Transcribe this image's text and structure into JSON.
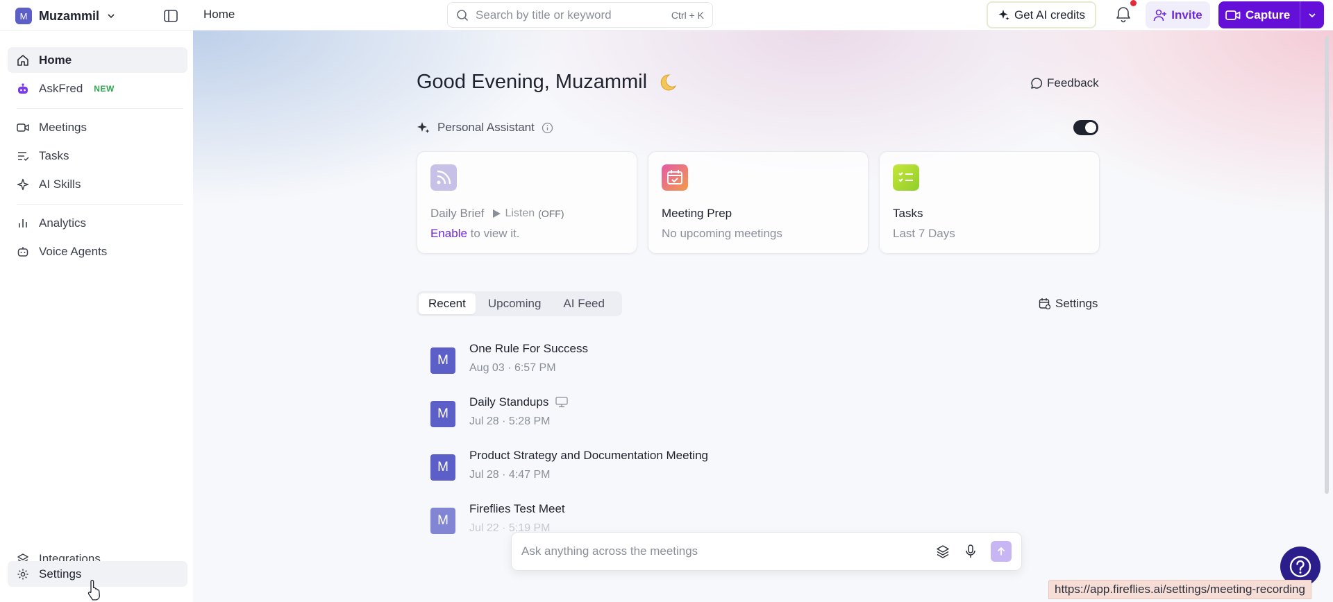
{
  "workspace": {
    "initial": "M",
    "name": "Muzammil"
  },
  "breadcrumb": {
    "current": "Home"
  },
  "search": {
    "placeholder": "Search by title or keyword",
    "shortcut": "Ctrl + K"
  },
  "topbar": {
    "credits_label": "Get AI credits",
    "invite_label": "Invite",
    "capture_label": "Capture"
  },
  "sidebar": {
    "items": [
      {
        "label": "Home",
        "icon": "home-icon",
        "active": true
      },
      {
        "label": "AskFred",
        "icon": "robot-icon",
        "badge": "NEW"
      },
      {
        "label": "Meetings",
        "icon": "video-icon"
      },
      {
        "label": "Tasks",
        "icon": "tasks-icon"
      },
      {
        "label": "AI Skills",
        "icon": "sparkle-icon"
      },
      {
        "label": "Analytics",
        "icon": "bar-chart-icon"
      },
      {
        "label": "Voice Agents",
        "icon": "bot-icon"
      }
    ],
    "bottom": [
      {
        "label": "Integrations",
        "icon": "layers-icon"
      },
      {
        "label": "Settings",
        "icon": "gear-icon",
        "hover": true
      }
    ]
  },
  "main": {
    "greeting": "Good Evening, Muzammil",
    "feedback_label": "Feedback",
    "assistant_label": "Personal Assistant",
    "assistant_enabled": true,
    "cards": [
      {
        "title": "Daily Brief",
        "listen": "Listen",
        "listen_state": "(OFF)",
        "enable_link": "Enable",
        "subtitle": "to view it."
      },
      {
        "title": "Meeting Prep",
        "subtitle": "No upcoming meetings"
      },
      {
        "title": "Tasks",
        "subtitle": "Last 7 Days"
      }
    ],
    "tabs": [
      {
        "label": "Recent",
        "active": true
      },
      {
        "label": "Upcoming"
      },
      {
        "label": "AI Feed"
      }
    ],
    "tabs_settings_label": "Settings",
    "meetings": [
      {
        "initial": "M",
        "title": "One Rule For Success",
        "date": "Aug 03",
        "time": "6:57 PM"
      },
      {
        "initial": "M",
        "title": "Daily Standups",
        "date": "Jul 28",
        "time": "5:28 PM",
        "screen_icon": true
      },
      {
        "initial": "M",
        "title": "Product Strategy and Documentation Meeting",
        "date": "Jul 28",
        "time": "4:47 PM"
      },
      {
        "initial": "M",
        "title": "Fireflies Test Meet",
        "date": "Jul 22",
        "time": "5:19 PM"
      }
    ],
    "ask_placeholder": "Ask anything across the meetings"
  },
  "status_url": "https://app.fireflies.ai/settings/meeting-recording",
  "colors": {
    "brand": "#6410d8",
    "avatar": "#5b5fc7",
    "help": "#2b1e8a"
  }
}
